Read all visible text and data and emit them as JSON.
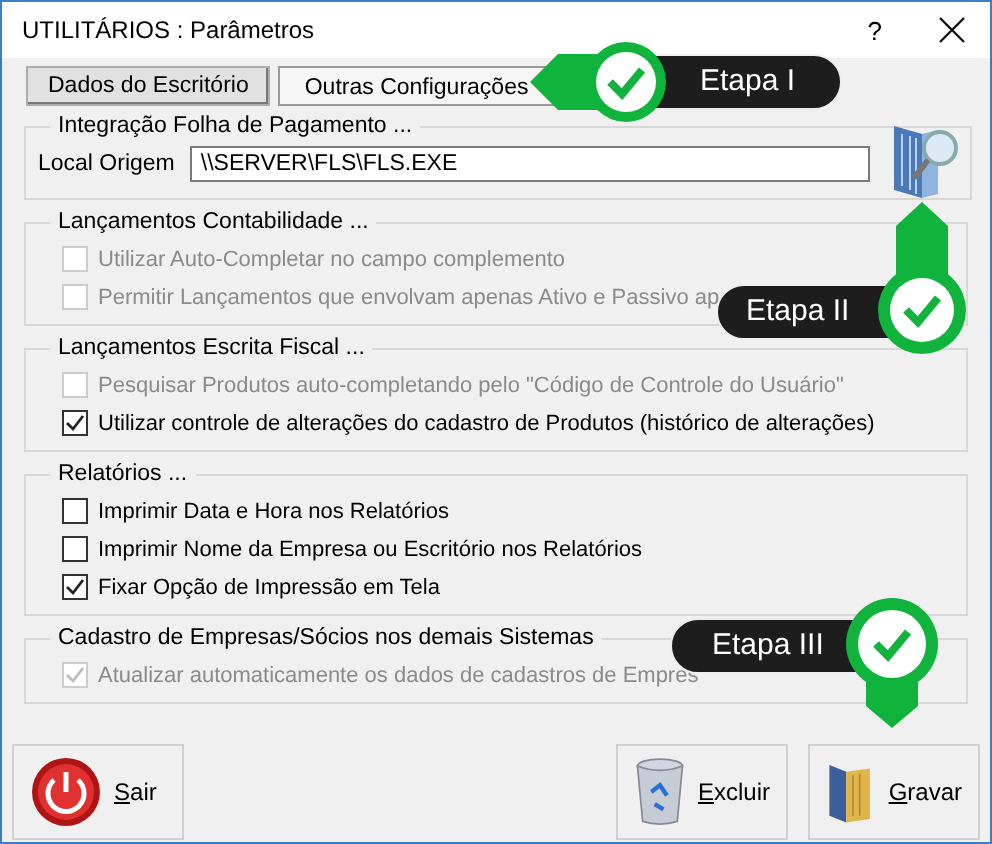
{
  "window": {
    "title": "UTILITÁRIOS : Parâmetros",
    "help": "?"
  },
  "tabs": [
    {
      "label": "Dados do Escritório",
      "selected": false
    },
    {
      "label": "Outras Configurações",
      "selected": true
    }
  ],
  "groups": [
    {
      "title": "Integração Folha de Pagamento ...",
      "kind": "field",
      "field": {
        "label": "Local Origem",
        "value": "\\\\SERVER\\FLS\\FLS.EXE"
      }
    },
    {
      "title": "Lançamentos Contabilidade ...",
      "kind": "options",
      "options": [
        {
          "label": "Utilizar Auto-Completar no campo complemento",
          "checked": false,
          "disabled": true
        },
        {
          "label": "Permitir Lançamentos que envolvam apenas Ativo e Passivo ap",
          "checked": false,
          "disabled": true
        }
      ]
    },
    {
      "title": "Lançamentos Escrita Fiscal ...",
      "kind": "options",
      "options": [
        {
          "label": "Pesquisar Produtos auto-completando pelo \"Código de Controle do Usuário\"",
          "checked": false,
          "disabled": true
        },
        {
          "label": "Utilizar controle de alterações do cadastro de Produtos (histórico de alterações)",
          "checked": true,
          "disabled": false
        }
      ]
    },
    {
      "title": "Relatórios ...",
      "kind": "options",
      "options": [
        {
          "label": "Imprimir Data e Hora nos Relatórios",
          "checked": false,
          "disabled": false
        },
        {
          "label": "Imprimir Nome da Empresa ou Escritório nos Relatórios",
          "checked": false,
          "disabled": false
        },
        {
          "label": "Fixar Opção de Impressão em Tela",
          "checked": true,
          "disabled": false
        }
      ]
    },
    {
      "title": "Cadastro de Empresas/Sócios nos demais Sistemas",
      "kind": "options",
      "options": [
        {
          "label": "Atualizar automaticamente os dados de cadastros de Empres",
          "checked": true,
          "disabled": true
        }
      ]
    }
  ],
  "buttons": [
    {
      "label": "Sair",
      "kind": "exit"
    },
    {
      "label": "Excluir",
      "kind": "delete"
    },
    {
      "label": "Gravar",
      "kind": "save"
    }
  ],
  "callouts": [
    {
      "label": "Etapa I"
    },
    {
      "label": "Etapa II"
    },
    {
      "label": "Etapa III"
    }
  ]
}
